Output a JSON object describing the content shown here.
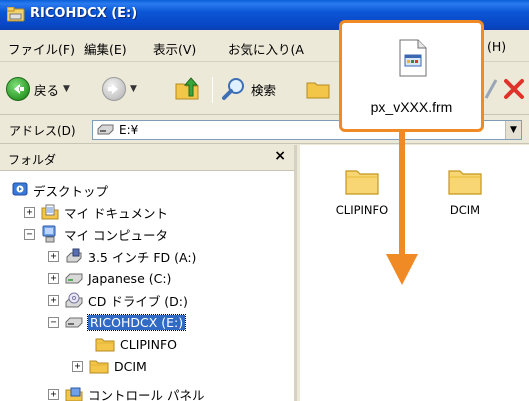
{
  "window": {
    "title": "RICOHDCX (E:)"
  },
  "menubar": {
    "items": [
      "ファイル(F)",
      "編集(E)",
      "表示(V)",
      "お気に入り(A",
      "(H)"
    ]
  },
  "toolbar": {
    "back_label": "戻る",
    "search_label": "検索"
  },
  "address": {
    "label": "アドレス(D)",
    "value": "E:¥"
  },
  "folder_pane": {
    "title": "フォルダ",
    "close": "×",
    "tree": [
      {
        "label": "デスクトップ",
        "icon": "desktop-icon",
        "expander": ""
      },
      {
        "label": "マイ ドキュメント",
        "icon": "my-documents-icon",
        "expander": "+"
      },
      {
        "label": "マイ コンピュータ",
        "icon": "my-computer-icon",
        "expander": "−"
      },
      {
        "label": "3.5 インチ FD (A:)",
        "icon": "floppy-drive-icon",
        "expander": "+"
      },
      {
        "label": "Japanese (C:)",
        "icon": "hard-drive-icon",
        "expander": "+"
      },
      {
        "label": "CD ドライブ (D:)",
        "icon": "cd-drive-icon",
        "expander": "+"
      },
      {
        "label": "RICOHDCX (E:)",
        "icon": "removable-drive-icon",
        "expander": "−",
        "selected": true
      },
      {
        "label": "CLIPINFO",
        "icon": "folder-icon",
        "expander": ""
      },
      {
        "label": "DCIM",
        "icon": "folder-icon",
        "expander": "+"
      },
      {
        "label": "コントロール パネル",
        "icon": "control-panel-icon",
        "expander": "+"
      }
    ]
  },
  "content": {
    "items": [
      {
        "label": "CLIPINFO",
        "icon": "folder-icon"
      },
      {
        "label": "DCIM",
        "icon": "folder-icon"
      }
    ]
  },
  "callout": {
    "filename": "px_vXXX.frm",
    "icon": "file-icon",
    "accent": "#f08a24"
  }
}
